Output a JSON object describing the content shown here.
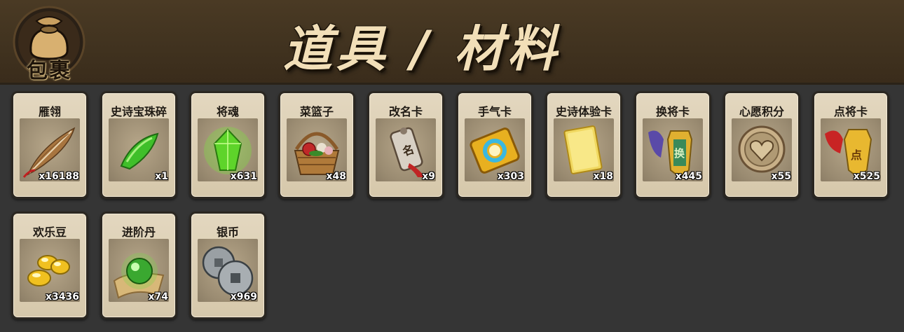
{
  "header": {
    "bag_label": "包裹",
    "title": "道具 / 材料"
  },
  "items": [
    {
      "name": "雁翎",
      "count": "x16188",
      "icon": "feather-icon"
    },
    {
      "name": "史诗宝珠碎",
      "count": "x1",
      "icon": "green-shard-icon"
    },
    {
      "name": "将魂",
      "count": "x631",
      "icon": "green-crystal-icon"
    },
    {
      "name": "菜篮子",
      "count": "x48",
      "icon": "basket-icon"
    },
    {
      "name": "改名卡",
      "count": "x9",
      "icon": "rename-tag-icon"
    },
    {
      "name": "手气卡",
      "count": "x303",
      "icon": "luck-card-icon"
    },
    {
      "name": "史诗体验卡",
      "count": "x18",
      "icon": "gold-card-icon"
    },
    {
      "name": "换将卡",
      "count": "x445",
      "icon": "swap-general-token-icon"
    },
    {
      "name": "心愿积分",
      "count": "x55",
      "icon": "heart-coin-icon"
    },
    {
      "name": "点将卡",
      "count": "x525",
      "icon": "pick-general-token-icon"
    },
    {
      "name": "欢乐豆",
      "count": "x3436",
      "icon": "gold-beans-icon"
    },
    {
      "name": "进阶丹",
      "count": "x74",
      "icon": "green-pill-icon"
    },
    {
      "name": "银币",
      "count": "x969",
      "icon": "silver-coins-icon"
    }
  ]
}
